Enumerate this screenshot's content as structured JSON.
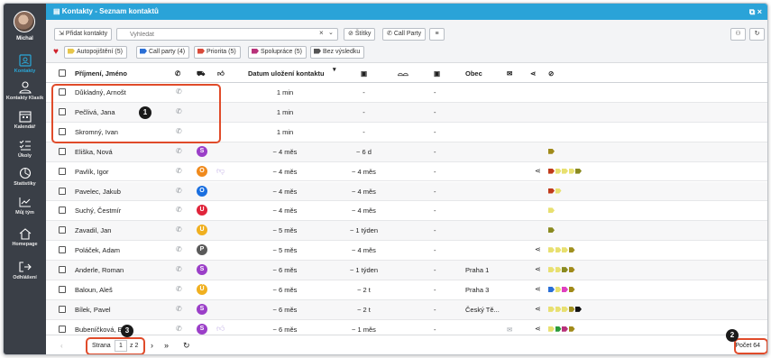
{
  "sidebar": {
    "user": "Michal",
    "items": [
      {
        "label": "Kontakty",
        "icon": "contacts-icon",
        "active": true
      },
      {
        "label": "Kontakty Klasik",
        "icon": "person-icon",
        "active": false
      },
      {
        "label": "Kalendář",
        "icon": "calendar-icon",
        "active": false
      },
      {
        "label": "Úkoly",
        "icon": "tasks-icon",
        "active": false
      },
      {
        "label": "Statistiky",
        "icon": "stats-icon",
        "active": false
      },
      {
        "label": "Můj tým",
        "icon": "team-chart-icon",
        "active": false
      },
      {
        "label": "Homepage",
        "icon": "home-icon",
        "active": false
      },
      {
        "label": "Odhlášení",
        "icon": "logout-icon",
        "active": false
      }
    ]
  },
  "window": {
    "title": "Kontakty - Seznam kontaktů",
    "controls": "⧉ ×"
  },
  "toolbar": {
    "add_label": "Přidat kontakty",
    "search_placeholder": "Vyhledat",
    "tags_label": "Štítky",
    "callparty_label": "Call Party"
  },
  "filters": [
    {
      "label": "Autopojištění (5)",
      "color": "#e7c64a"
    },
    {
      "label": "Call party (4)",
      "color": "#2b6fd6"
    },
    {
      "label": "Priorita (5)",
      "color": "#d94a3a"
    },
    {
      "label": "Spolupráce (5)",
      "color": "#b8327a"
    },
    {
      "label": "Bez výsledku",
      "color": "#555555"
    }
  ],
  "columns": {
    "name": "Příjmení, Jméno",
    "saved": "Datum uložení kontaktu",
    "city": "Obec"
  },
  "rows": [
    {
      "name": "Důkladný, Arnošt",
      "saved": "1 min",
      "c2": "-",
      "c3": "-",
      "badge": "",
      "badge_color": "",
      "city": "",
      "share": false,
      "tags": [],
      "mail": false,
      "thumb": ""
    },
    {
      "name": "Pečlivá, Jana",
      "saved": "1 min",
      "c2": "-",
      "c3": "-",
      "badge": "",
      "badge_color": "",
      "city": "",
      "share": false,
      "tags": [],
      "mail": false,
      "thumb": ""
    },
    {
      "name": "Skromný, Ivan",
      "saved": "1 min",
      "c2": "-",
      "c3": "-",
      "badge": "",
      "badge_color": "",
      "city": "",
      "share": false,
      "tags": [],
      "mail": false,
      "thumb": ""
    },
    {
      "name": "Eliška, Nová",
      "saved": "~ 4 měs",
      "c2": "~ 6 d",
      "c3": "-",
      "badge": "S",
      "badge_color": "#9b3fc8",
      "city": "",
      "share": false,
      "tags": [
        "#a08a1a"
      ],
      "mail": false,
      "thumb": ""
    },
    {
      "name": "Pavlík, Igor",
      "saved": "~ 4 měs",
      "c2": "~ 4 měs",
      "c3": "-",
      "badge": "O",
      "badge_color": "#f08a1c",
      "city": "",
      "share": true,
      "tags": [
        "#c03a1a",
        "#e8e070",
        "#e8e070",
        "#e8e070",
        "#8a8a20"
      ],
      "mail": false,
      "thumb": "down"
    },
    {
      "name": "Pavelec, Jakub",
      "saved": "~ 4 měs",
      "c2": "~ 4 měs",
      "c3": "-",
      "badge": "O",
      "badge_color": "#1a6fe0",
      "city": "",
      "share": false,
      "tags": [
        "#c03a1a",
        "#e8e070"
      ],
      "mail": false,
      "thumb": ""
    },
    {
      "name": "Suchý, Čestmír",
      "saved": "~ 4 měs",
      "c2": "~ 4 měs",
      "c3": "-",
      "badge": "U",
      "badge_color": "#e0243a",
      "city": "",
      "share": false,
      "tags": [
        "#e8e070"
      ],
      "mail": false,
      "thumb": ""
    },
    {
      "name": "Zavadil, Jan",
      "saved": "~ 5 měs",
      "c2": "~ 1 týden",
      "c3": "-",
      "badge": "U",
      "badge_color": "#f0b020",
      "city": "",
      "share": false,
      "tags": [
        "#8a8a20"
      ],
      "mail": false,
      "thumb": ""
    },
    {
      "name": "Poláček, Adam",
      "saved": "~ 5 měs",
      "c2": "~ 4 měs",
      "c3": "-",
      "badge": "P",
      "badge_color": "#5a5a5a",
      "city": "",
      "share": true,
      "tags": [
        "#e8e070",
        "#e8e070",
        "#e8e070",
        "#a09020"
      ],
      "mail": false,
      "thumb": ""
    },
    {
      "name": "Anderle, Roman",
      "saved": "~ 6 měs",
      "c2": "~ 1 týden",
      "c3": "-",
      "badge": "S",
      "badge_color": "#9b3fc8",
      "city": "Praha 1",
      "share": true,
      "tags": [
        "#e8e070",
        "#e8e070",
        "#8a8a20",
        "#a08a1a"
      ],
      "mail": false,
      "thumb": ""
    },
    {
      "name": "Baloun, Aleš",
      "saved": "~ 6 měs",
      "c2": "~ 2 t",
      "c3": "-",
      "badge": "Ú",
      "badge_color": "#f0b020",
      "city": "Praha 3",
      "share": true,
      "tags": [
        "#2a6fd6",
        "#e8e070",
        "#e040c0",
        "#a08a1a"
      ],
      "mail": false,
      "thumb": ""
    },
    {
      "name": "Bílek, Pavel",
      "saved": "~ 6 měs",
      "c2": "~ 2 t",
      "c3": "-",
      "badge": "S",
      "badge_color": "#9b3fc8",
      "city": "Český Tě...",
      "share": true,
      "tags": [
        "#e8e070",
        "#e8e070",
        "#e8e070",
        "#a09020",
        "#111111"
      ],
      "mail": false,
      "thumb": ""
    },
    {
      "name": "Bubeníčková, E",
      "saved": "~ 6 měs",
      "c2": "~ 1 měs",
      "c3": "-",
      "badge": "S",
      "badge_color": "#9b3fc8",
      "city": "",
      "share": true,
      "tags": [
        "#e8e070",
        "#2a9a3a",
        "#b8327a",
        "#a08a1a"
      ],
      "mail": true,
      "thumb": "up"
    }
  ],
  "pagination": {
    "page_label": "Strana",
    "page": "1",
    "of": "z 2",
    "count": "Počet 64"
  },
  "callouts": [
    "1",
    "2",
    "3"
  ]
}
